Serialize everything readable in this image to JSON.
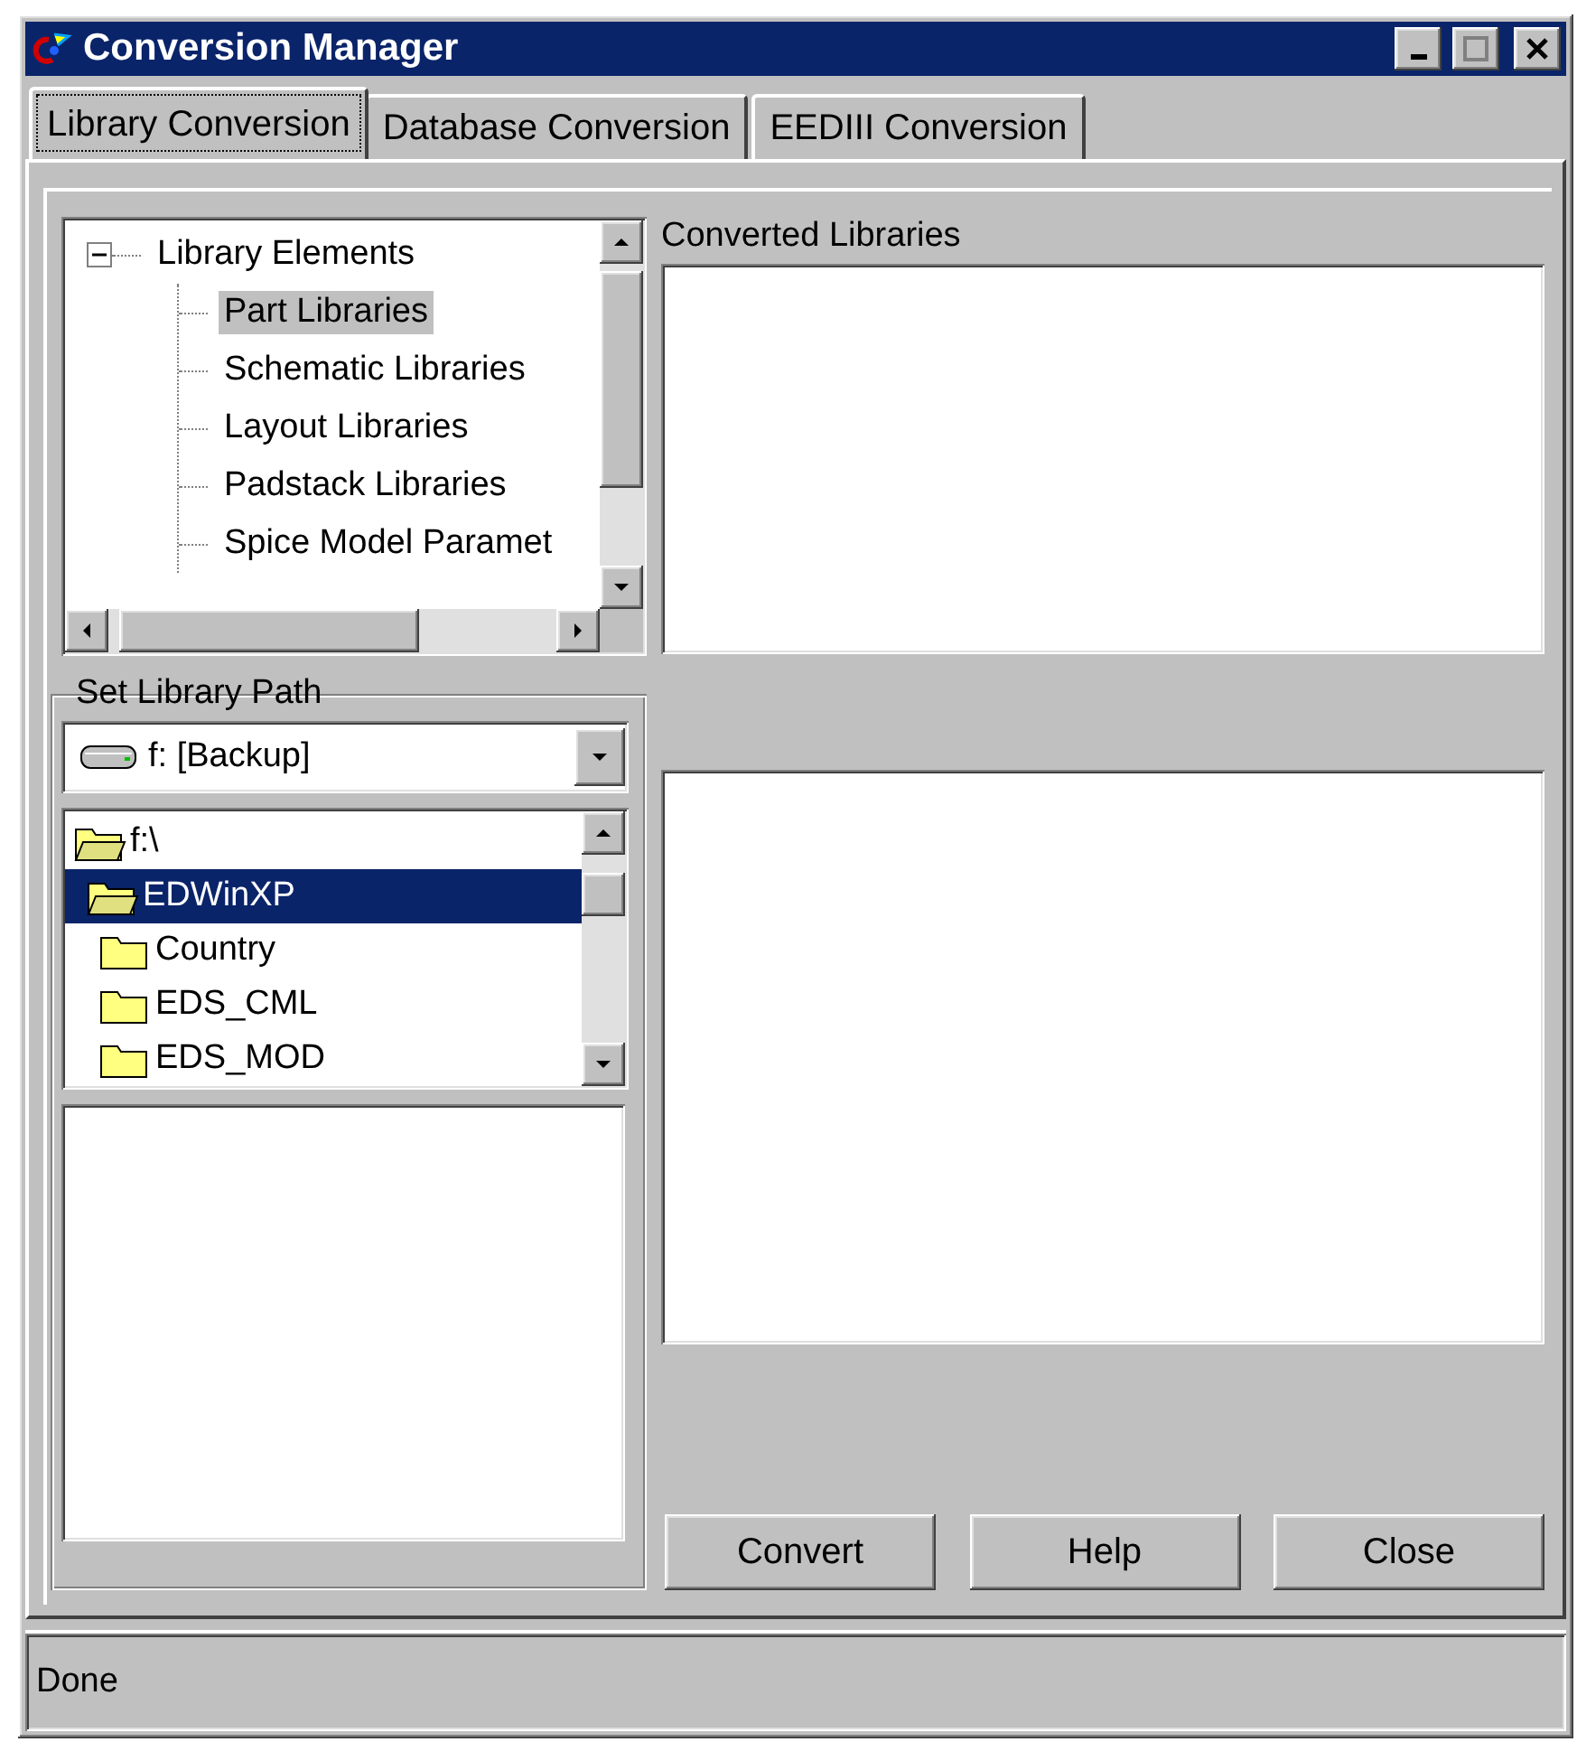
{
  "window": {
    "title": "Conversion Manager"
  },
  "tabs": [
    {
      "label": "Library Conversion",
      "selected": true
    },
    {
      "label": "Database Conversion",
      "selected": false
    },
    {
      "label": "EEDIII Conversion",
      "selected": false
    }
  ],
  "library_tree": {
    "label": "Library Elements",
    "expanded": true,
    "children": [
      {
        "label": "Part Libraries",
        "selected": true
      },
      {
        "label": "Schematic Libraries",
        "selected": false
      },
      {
        "label": "Layout Libraries",
        "selected": false
      },
      {
        "label": "Padstack Libraries",
        "selected": false
      },
      {
        "label": "Spice Model Paramet",
        "selected": false
      }
    ]
  },
  "converted_libraries": {
    "label": "Converted Libraries"
  },
  "library_path": {
    "label": "Set Library Path",
    "drive": "f: [Backup]",
    "folders": [
      {
        "label": "f:\\",
        "open": true,
        "selected": false,
        "children": [
          {
            "label": "EDWinXP",
            "open": true,
            "selected": true,
            "children": [
              {
                "label": "Country",
                "open": false,
                "selected": false
              },
              {
                "label": "EDS_CML",
                "open": false,
                "selected": false
              },
              {
                "label": "EDS_MOD",
                "open": false,
                "selected": false
              }
            ]
          }
        ]
      }
    ]
  },
  "buttons": [
    "Convert",
    "Help",
    "Close"
  ],
  "status_bar": "Done"
}
